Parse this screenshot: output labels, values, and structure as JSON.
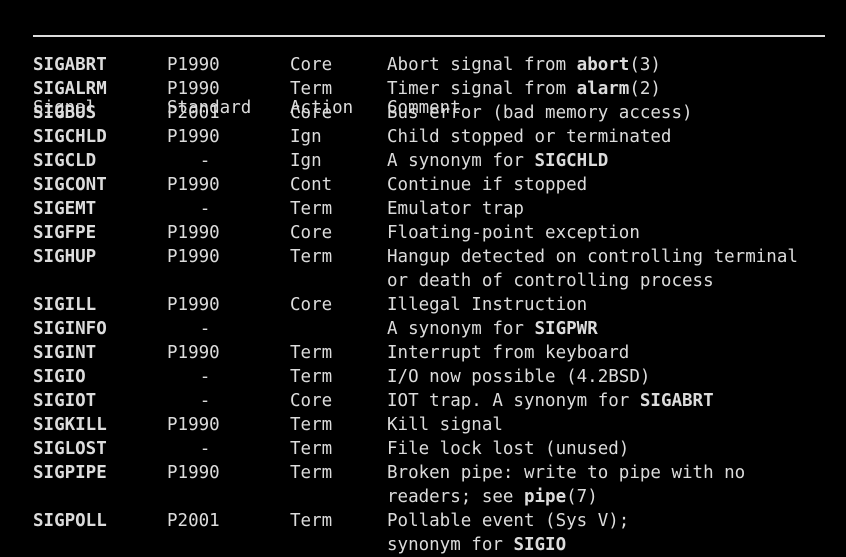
{
  "page": {
    "kind": "man-page-signal-table",
    "background_color": "#000000",
    "text_color": "#dcdcdc"
  },
  "table": {
    "columns": [
      {
        "key": "signal",
        "label": "Signal"
      },
      {
        "key": "standard",
        "label": "Standard"
      },
      {
        "key": "action",
        "label": "Action"
      },
      {
        "key": "comment",
        "label": "Comment"
      }
    ],
    "rows": [
      {
        "signal": "SIGABRT",
        "standard": "P1990",
        "action": "Core",
        "comment_pre": "Abort signal from ",
        "comment_bold": "abort",
        "comment_post": "(3)",
        "cont": ""
      },
      {
        "signal": "SIGALRM",
        "standard": "P1990",
        "action": "Term",
        "comment_pre": "Timer signal from ",
        "comment_bold": "alarm",
        "comment_post": "(2)",
        "cont": ""
      },
      {
        "signal": "SIGBUS",
        "standard": "P2001",
        "action": "Core",
        "comment_pre": "Bus error (bad memory access)",
        "comment_bold": "",
        "comment_post": "",
        "cont": ""
      },
      {
        "signal": "SIGCHLD",
        "standard": "P1990",
        "action": "Ign",
        "comment_pre": "Child stopped or terminated",
        "comment_bold": "",
        "comment_post": "",
        "cont": ""
      },
      {
        "signal": "SIGCLD",
        "standard": "-",
        "action": "Ign",
        "comment_pre": "A synonym for ",
        "comment_bold": "SIGCHLD",
        "comment_post": "",
        "cont": ""
      },
      {
        "signal": "SIGCONT",
        "standard": "P1990",
        "action": "Cont",
        "comment_pre": "Continue if stopped",
        "comment_bold": "",
        "comment_post": "",
        "cont": ""
      },
      {
        "signal": "SIGEMT",
        "standard": "-",
        "action": "Term",
        "comment_pre": "Emulator trap",
        "comment_bold": "",
        "comment_post": "",
        "cont": ""
      },
      {
        "signal": "SIGFPE",
        "standard": "P1990",
        "action": "Core",
        "comment_pre": "Floating-point exception",
        "comment_bold": "",
        "comment_post": "",
        "cont": ""
      },
      {
        "signal": "SIGHUP",
        "standard": "P1990",
        "action": "Term",
        "comment_pre": "Hangup detected on controlling terminal",
        "comment_bold": "",
        "comment_post": "",
        "cont": "or death of controlling process"
      },
      {
        "signal": "SIGILL",
        "standard": "P1990",
        "action": "Core",
        "comment_pre": "Illegal Instruction",
        "comment_bold": "",
        "comment_post": "",
        "cont": ""
      },
      {
        "signal": "SIGINFO",
        "standard": "-",
        "action": "",
        "comment_pre": "A synonym for ",
        "comment_bold": "SIGPWR",
        "comment_post": "",
        "cont": ""
      },
      {
        "signal": "SIGINT",
        "standard": "P1990",
        "action": "Term",
        "comment_pre": "Interrupt from keyboard",
        "comment_bold": "",
        "comment_post": "",
        "cont": ""
      },
      {
        "signal": "SIGIO",
        "standard": "-",
        "action": "Term",
        "comment_pre": "I/O now possible (4.2BSD)",
        "comment_bold": "",
        "comment_post": "",
        "cont": ""
      },
      {
        "signal": "SIGIOT",
        "standard": "-",
        "action": "Core",
        "comment_pre": "IOT trap. A synonym for ",
        "comment_bold": "SIGABRT",
        "comment_post": "",
        "cont": ""
      },
      {
        "signal": "SIGKILL",
        "standard": "P1990",
        "action": "Term",
        "comment_pre": "Kill signal",
        "comment_bold": "",
        "comment_post": "",
        "cont": ""
      },
      {
        "signal": "SIGLOST",
        "standard": "-",
        "action": "Term",
        "comment_pre": "File lock lost (unused)",
        "comment_bold": "",
        "comment_post": "",
        "cont": ""
      },
      {
        "signal": "SIGPIPE",
        "standard": "P1990",
        "action": "Term",
        "comment_pre": "Broken pipe: write to pipe with no",
        "comment_bold": "",
        "comment_post": "",
        "cont": "readers; see ",
        "cont_bold": "pipe",
        "cont_post": "(7)"
      },
      {
        "signal": "SIGPOLL",
        "standard": "P2001",
        "action": "Term",
        "comment_pre": "Pollable event (Sys V);",
        "comment_bold": "",
        "comment_post": "",
        "cont": "synonym for ",
        "cont_bold": "SIGIO",
        "cont_post": ""
      }
    ]
  }
}
